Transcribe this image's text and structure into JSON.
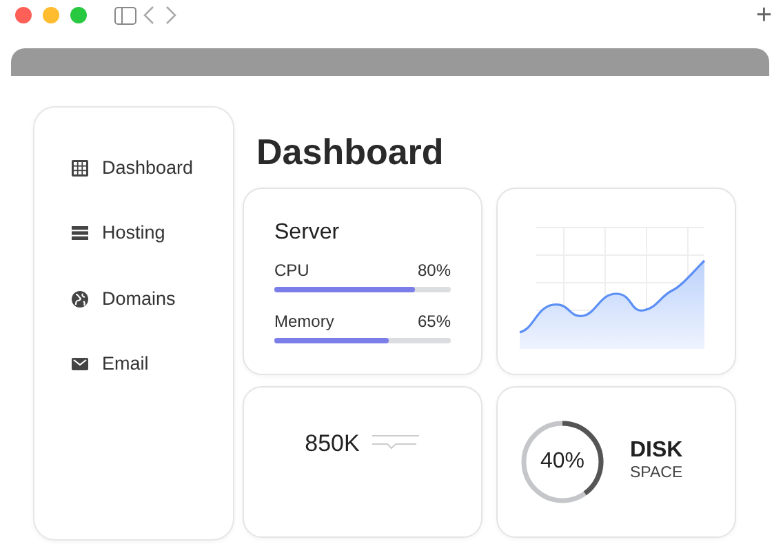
{
  "window": {
    "new_tab_label": "+"
  },
  "sidebar": {
    "items": [
      {
        "label": "Dashboard"
      },
      {
        "label": "Hosting"
      },
      {
        "label": "Domains"
      },
      {
        "label": "Email"
      }
    ]
  },
  "page_title": "Dashboard",
  "server": {
    "title": "Server",
    "meters": [
      {
        "name": "CPU",
        "reading": "80%",
        "level": 0.8
      },
      {
        "name": "Memory",
        "reading": "65%",
        "level": 0.65
      }
    ]
  },
  "traffic": {
    "value": "850K"
  },
  "disk": {
    "reading": "40%",
    "level": 0.4,
    "title": "DISK",
    "subtitle": "SPACE"
  }
}
